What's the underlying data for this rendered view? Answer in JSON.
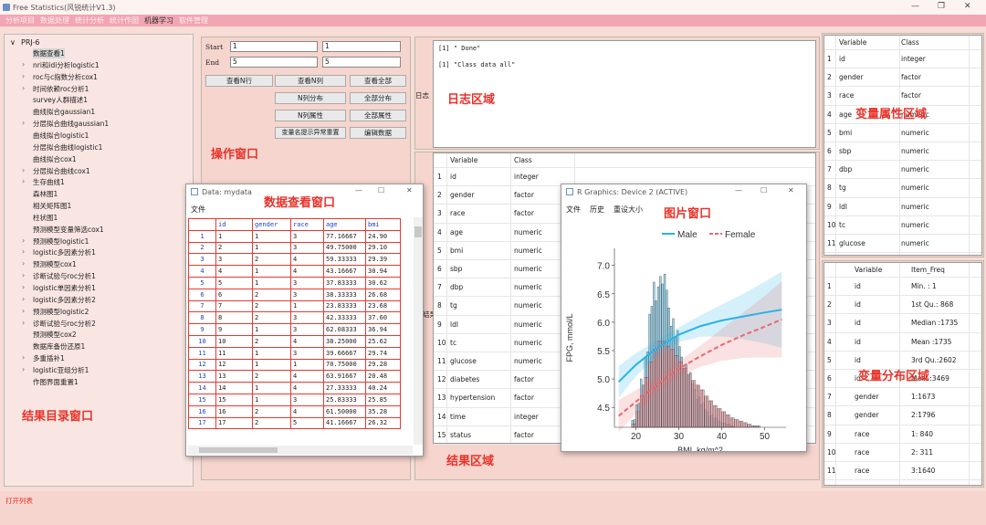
{
  "app": {
    "title": "Free Statistics(风锐统计V1.3)",
    "menu": [
      "分析项目",
      "数据处理",
      "统计分析",
      "统计作图",
      "机器学习",
      "软件管理"
    ],
    "active_menu": "机器学习"
  },
  "tree": {
    "root": "PRJ-6",
    "items": [
      {
        "label": "数据查看1",
        "exp": false,
        "sel": true
      },
      {
        "label": "nri和idi分析logistic1",
        "exp": true
      },
      {
        "label": "roc与c指数分析cox1",
        "exp": true
      },
      {
        "label": "时间依赖roc分析1",
        "exp": true
      },
      {
        "label": "survey人群描述1",
        "exp": false
      },
      {
        "label": "曲线拟合gaussian1",
        "exp": false
      },
      {
        "label": "分层拟合曲线gaussian1",
        "exp": true
      },
      {
        "label": "曲线拟合logistic1",
        "exp": false
      },
      {
        "label": "分层拟合曲线logistic1",
        "exp": false
      },
      {
        "label": "曲线拟合cox1",
        "exp": false
      },
      {
        "label": "分层拟合曲线cox1",
        "exp": true
      },
      {
        "label": "生存曲线1",
        "exp": true
      },
      {
        "label": "森林图1",
        "exp": false
      },
      {
        "label": "相关矩阵图1",
        "exp": false
      },
      {
        "label": "柱状图1",
        "exp": false
      },
      {
        "label": "预测模型变量筛选cox1",
        "exp": false
      },
      {
        "label": "预测模型logistic1",
        "exp": true
      },
      {
        "label": "logistic多因素分析1",
        "exp": true
      },
      {
        "label": "预测模型cox1",
        "exp": true
      },
      {
        "label": "诊断试验与roc分析1",
        "exp": true
      },
      {
        "label": "logistic单因素分析1",
        "exp": true
      },
      {
        "label": "logistic多因素分析2",
        "exp": true
      },
      {
        "label": "预测模型logistic2",
        "exp": true
      },
      {
        "label": "诊断试验与roc分析2",
        "exp": true
      },
      {
        "label": "预测模型cox2",
        "exp": false
      },
      {
        "label": "数据库备份还原1",
        "exp": false
      },
      {
        "label": "多重插补1",
        "exp": true
      },
      {
        "label": "logistic亚组分析1",
        "exp": true
      },
      {
        "label": "作图界面重置1",
        "exp": false
      }
    ],
    "caption": "结果目录窗口"
  },
  "ops": {
    "start_label": "Start",
    "end_label": "End",
    "start1": "1",
    "start2": "1",
    "end1": "5",
    "end2": "5",
    "buttons": [
      "查看N行",
      "查看N列",
      "查看全部",
      "N列分布",
      "全部分布",
      "N列属性",
      "全部属性",
      "变量名提示异常重置",
      "编辑数据"
    ],
    "caption": "操作窗口"
  },
  "log": {
    "label": "日志",
    "lines": [
      "[1] \" Done\"",
      "[1] \"Class data all\""
    ],
    "caption": "日志区域"
  },
  "result": {
    "label": "结果",
    "caption": "结果区域",
    "headers": [
      "Variable",
      "Class"
    ],
    "rows": [
      [
        "1",
        "id",
        "integer"
      ],
      [
        "2",
        "gender",
        "factor"
      ],
      [
        "3",
        "race",
        "factor"
      ],
      [
        "4",
        "age",
        "numeric"
      ],
      [
        "5",
        "bmi",
        "numeric"
      ],
      [
        "6",
        "sbp",
        "numeric"
      ],
      [
        "7",
        "dbp",
        "numeric"
      ],
      [
        "8",
        "tg",
        "numeric"
      ],
      [
        "9",
        "ldl",
        "numeric"
      ],
      [
        "10",
        "tc",
        "numeric"
      ],
      [
        "11",
        "glucose",
        "numeric"
      ],
      [
        "12",
        "diabetes",
        "factor"
      ],
      [
        "13",
        "hypertension",
        "factor"
      ],
      [
        "14",
        "time",
        "integer"
      ],
      [
        "15",
        "status",
        "factor"
      ]
    ]
  },
  "varprop": {
    "caption": "变量属性区域",
    "headers": [
      "Variable",
      "Class"
    ],
    "rows": [
      [
        "1",
        "id",
        "integer"
      ],
      [
        "2",
        "gender",
        "factor"
      ],
      [
        "3",
        "race",
        "factor"
      ],
      [
        "4",
        "age",
        "numeric"
      ],
      [
        "5",
        "bmi",
        "numeric"
      ],
      [
        "6",
        "sbp",
        "numeric"
      ],
      [
        "7",
        "dbp",
        "numeric"
      ],
      [
        "8",
        "tg",
        "numeric"
      ],
      [
        "9",
        "ldl",
        "numeric"
      ],
      [
        "10",
        "tc",
        "numeric"
      ],
      [
        "11",
        "glucose",
        "numeric"
      ]
    ]
  },
  "vardist": {
    "caption": "变量分布区域",
    "headers": [
      "Variable",
      "Item_Freq"
    ],
    "rows": [
      [
        "1",
        "id",
        "Min.   :   1"
      ],
      [
        "2",
        "id",
        "1st Qu.: 868"
      ],
      [
        "3",
        "id",
        "Median :1735"
      ],
      [
        "4",
        "id",
        "Mean   :1735"
      ],
      [
        "5",
        "id",
        "3rd Qu.:2602"
      ],
      [
        "6",
        "id",
        "Max.   :3469"
      ],
      [
        "7",
        "gender",
        "1:1673"
      ],
      [
        "8",
        "gender",
        "2:1796"
      ],
      [
        "9",
        "race",
        "1: 840"
      ],
      [
        "10",
        "race",
        "2: 311"
      ],
      [
        "11",
        "race",
        "3:1640"
      ]
    ]
  },
  "dataview": {
    "title": "Data: mydata",
    "menu": "文件",
    "caption": "数据查看窗口",
    "headers": [
      "",
      "id",
      "gender",
      "race",
      "age",
      "bmi"
    ],
    "rows": [
      [
        "1",
        "1",
        "1",
        "3",
        "77.16667",
        "24.90"
      ],
      [
        "2",
        "2",
        "1",
        "3",
        "49.75000",
        "29.10"
      ],
      [
        "3",
        "3",
        "2",
        "4",
        "59.33333",
        "29.39"
      ],
      [
        "4",
        "4",
        "1",
        "4",
        "43.16667",
        "30.94"
      ],
      [
        "5",
        "5",
        "1",
        "3",
        "37.83333",
        "30.62"
      ],
      [
        "6",
        "6",
        "2",
        "3",
        "38.33333",
        "26.68"
      ],
      [
        "7",
        "7",
        "2",
        "1",
        "23.83333",
        "23.68"
      ],
      [
        "8",
        "8",
        "2",
        "3",
        "42.33333",
        "37.60"
      ],
      [
        "9",
        "9",
        "1",
        "3",
        "62.08333",
        "36.94"
      ],
      [
        "10",
        "10",
        "2",
        "4",
        "38.25000",
        "25.62"
      ],
      [
        "11",
        "11",
        "1",
        "3",
        "39.66667",
        "29.74"
      ],
      [
        "12",
        "12",
        "1",
        "1",
        "70.75000",
        "29.28"
      ],
      [
        "13",
        "13",
        "2",
        "4",
        "63.91667",
        "20.48"
      ],
      [
        "14",
        "14",
        "1",
        "4",
        "27.33333",
        "40.24"
      ],
      [
        "15",
        "15",
        "1",
        "3",
        "25.83333",
        "25.85"
      ],
      [
        "16",
        "16",
        "2",
        "4",
        "61.50000",
        "35.28"
      ],
      [
        "17",
        "17",
        "2",
        "5",
        "41.16667",
        "26.32"
      ]
    ]
  },
  "graphics": {
    "title": "R Graphics: Device 2 (ACTIVE)",
    "menu": [
      "文件",
      "历史",
      "重设大小"
    ],
    "caption": "图片窗口"
  },
  "chart_data": {
    "type": "line",
    "xlabel": "BMI, kg/m^2",
    "ylabel": "FPG, mmol/L",
    "xlim": [
      15,
      55
    ],
    "ylim": [
      4.15,
      7.3
    ],
    "x_ticks": [
      20,
      30,
      40,
      50
    ],
    "y_ticks": [
      4.5,
      5.0,
      5.5,
      6.0,
      6.5,
      7.0
    ],
    "series": [
      {
        "name": "Male",
        "color": "#27b3e8",
        "x": [
          16,
          20,
          25,
          30,
          35,
          40,
          45,
          50,
          54
        ],
        "y": [
          4.95,
          5.25,
          5.55,
          5.78,
          5.93,
          6.03,
          6.1,
          6.17,
          6.22
        ]
      },
      {
        "name": "Female",
        "color": "#e8686e",
        "x": [
          16,
          20,
          25,
          30,
          35,
          40,
          45,
          50,
          54
        ],
        "y": [
          4.35,
          4.6,
          4.9,
          5.18,
          5.4,
          5.6,
          5.77,
          5.92,
          6.05
        ]
      }
    ],
    "histogram": {
      "x": [
        19,
        20,
        21,
        22,
        23,
        24,
        25,
        26,
        27,
        28,
        29,
        30,
        31,
        32,
        33,
        34,
        35,
        36,
        37,
        38,
        39,
        40,
        41,
        42,
        43,
        44,
        45,
        46,
        47,
        48
      ],
      "male": [
        0.05,
        0.15,
        0.3,
        0.5,
        0.75,
        0.9,
        1.0,
        0.95,
        0.85,
        0.72,
        0.6,
        0.5,
        0.42,
        0.34,
        0.27,
        0.2,
        0.15,
        0.11,
        0.08,
        0.06,
        0.04,
        0.03,
        0.02,
        0.01,
        0,
        0,
        0,
        0,
        0,
        0
      ],
      "female": [
        0.02,
        0.1,
        0.2,
        0.32,
        0.42,
        0.5,
        0.55,
        0.55,
        0.52,
        0.5,
        0.46,
        0.42,
        0.38,
        0.34,
        0.3,
        0.27,
        0.24,
        0.2,
        0.17,
        0.14,
        0.12,
        0.1,
        0.08,
        0.06,
        0.05,
        0.04,
        0.03,
        0.02,
        0.01,
        0.01
      ]
    }
  }
}
